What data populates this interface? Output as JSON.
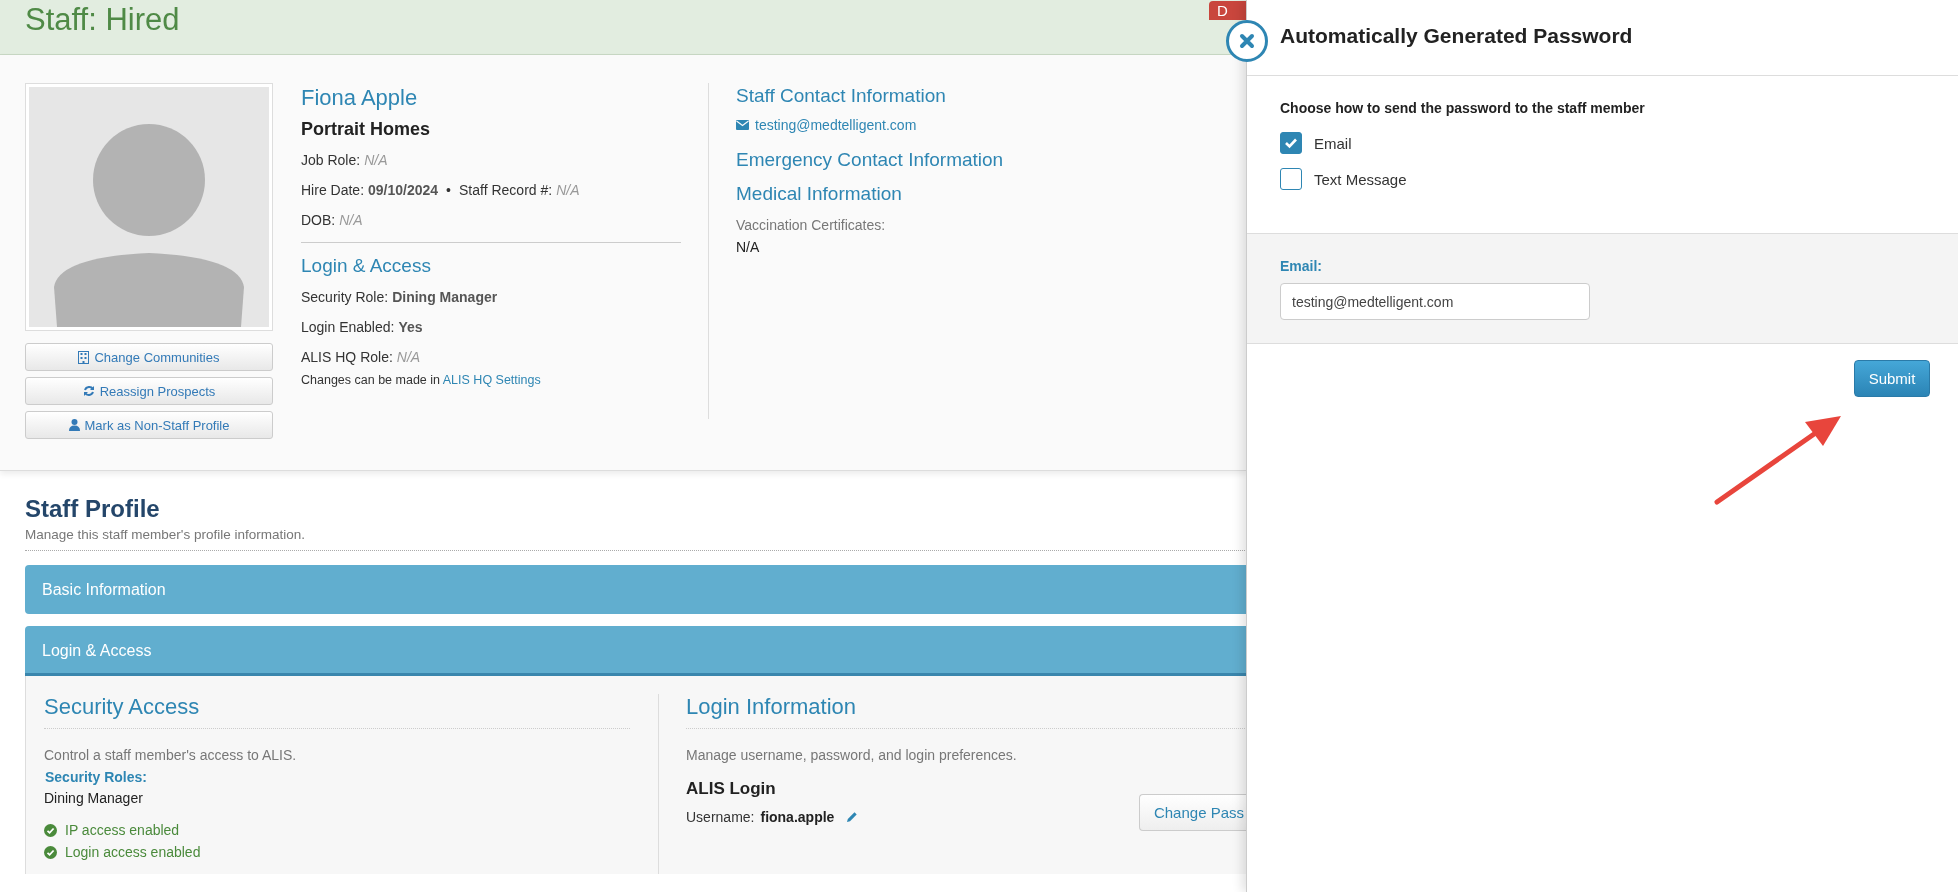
{
  "header": {
    "title": "Staff: Hired",
    "action_button": "D"
  },
  "profile": {
    "buttons": [
      "Change Communities",
      "Reassign Prospects",
      "Mark as Non-Staff Profile"
    ],
    "name": "Fiona Apple",
    "community": "Portrait Homes",
    "separator": "•",
    "details": [
      [
        {
          "label": "Job Role:",
          "value": "N/A",
          "kind": "missing"
        }
      ],
      [
        {
          "label": "Hire Date:",
          "value": "09/10/2024",
          "kind": "bold"
        },
        {
          "label": "Staff Record #:",
          "value": "N/A",
          "kind": "missing"
        }
      ],
      [
        {
          "label": "DOB:",
          "value": "N/A",
          "kind": "missing"
        }
      ]
    ],
    "login_heading": "Login & Access",
    "login_items": [
      {
        "label": "Security Role:",
        "value": "Dining Manager",
        "kind": "bold"
      },
      {
        "label": "Login Enabled:",
        "value": "Yes",
        "kind": "bold"
      },
      {
        "label": "ALIS HQ Role:",
        "value": "N/A",
        "kind": "missing"
      }
    ],
    "note": "Changes can be made in",
    "note_link": "ALIS HQ Settings",
    "contact_heading": "Staff Contact Information",
    "email": "testing@medtelligent.com",
    "emergency_heading": "Emergency Contact Information",
    "medical_heading": "Medical Information",
    "vaccination_label": "Vaccination Certificates:",
    "vaccination_value": "N/A"
  },
  "staff_profile": {
    "title": "Staff Profile",
    "subtitle": "Manage this staff member's profile information.",
    "sections": [
      {
        "label": "Basic Information",
        "expanded": false
      },
      {
        "label": "Login & Access",
        "expanded": true
      }
    ]
  },
  "security_access": {
    "heading": "Security Access",
    "description": "Control a staff member's access to ALIS.",
    "roles_label": "Security Roles:",
    "roles_value": "Dining Manager",
    "statuses": [
      {
        "label": "IP access enabled",
        "enabled": true
      },
      {
        "label": "Login access enabled",
        "enabled": true
      }
    ]
  },
  "login_information": {
    "heading": "Login Information",
    "description": "Manage username, password, and login preferences.",
    "subheading": "ALIS Login",
    "username_label": "Username:",
    "username": "fiona.apple",
    "button": "Change Pass"
  },
  "dialog": {
    "title": "Automatically Generated Password",
    "prompt": "Choose how to send the password to the staff member",
    "options": [
      {
        "label": "Email",
        "checked": true
      },
      {
        "label": "Text Message",
        "checked": false
      }
    ],
    "email_label": "Email:",
    "email_value": "testing@medtelligent.com",
    "submit": "Submit"
  }
}
